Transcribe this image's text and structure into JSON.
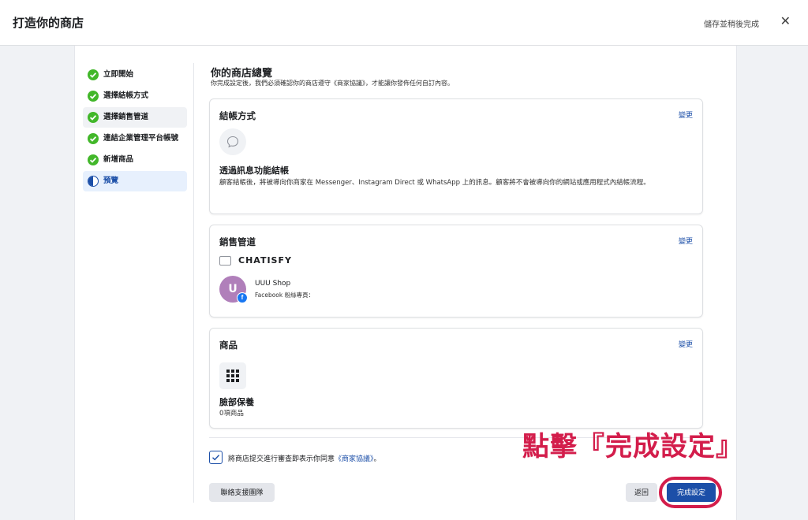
{
  "header": {
    "title": "打造你的商店",
    "save_later": "儲存並稍後完成",
    "close_icon": "close-icon"
  },
  "steps": [
    {
      "label": "立即開始",
      "state": "done"
    },
    {
      "label": "選擇結帳方式",
      "state": "done"
    },
    {
      "label": "選擇銷售管道",
      "state": "done"
    },
    {
      "label": "連結企業管理平台帳號",
      "state": "done"
    },
    {
      "label": "新增商品",
      "state": "done"
    },
    {
      "label": "預覽",
      "state": "in-progress"
    }
  ],
  "overview": {
    "title": "你的商店總覽",
    "subtitle": "你完成設定後，我們必須確認你的商店遵守《商家協議》，才能讓你發佈任何自訂內容。"
  },
  "checkout": {
    "title": "結帳方式",
    "change": "變更",
    "icon": "chat-bubble-icon",
    "method": "透過訊息功能結帳",
    "description": "顧客結帳後，將被導向你商家在 Messenger、Instagram Direct 或 WhatsApp 上的訊息。顧客將不會被導向你的網站或應用程式內結帳流程。"
  },
  "sales_channel": {
    "title": "銷售管道",
    "change": "變更",
    "partner": "CHATISFY",
    "page_initial": "U",
    "page_name": "UUU Shop",
    "page_type": "Facebook 粉絲專頁："
  },
  "products": {
    "title": "商品",
    "change": "變更",
    "icon": "grid-icon",
    "collection_name": "臉部保養",
    "count": "0項商品"
  },
  "agreement": {
    "checked": true,
    "text": "將商店提交進行審查即表示你同意",
    "link": "《商家協議》",
    "suffix": "。"
  },
  "buttons": {
    "support": "聯絡支援團隊",
    "back": "返回",
    "finish": "完成設定"
  },
  "annotation": "點擊『完成設定』",
  "colors": {
    "accent": "#1c4fa8",
    "success": "#42b72a",
    "annotation": "#d31d4b"
  }
}
